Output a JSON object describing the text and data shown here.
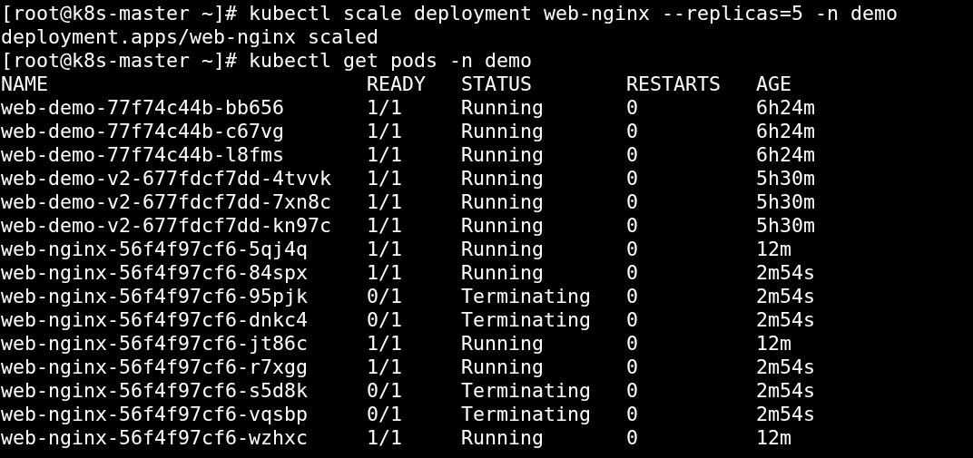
{
  "terminal": {
    "lines": [
      {
        "kind": "prompt",
        "prompt": "[root@k8s-master ~]#",
        "command": "kubectl scale deployment web-nginx --replicas=5 -n demo"
      },
      {
        "kind": "output",
        "text": "deployment.apps/web-nginx scaled"
      },
      {
        "kind": "prompt",
        "prompt": "[root@k8s-master ~]#",
        "command": "kubectl get pods -n demo"
      }
    ],
    "table": {
      "columns": [
        "NAME",
        "READY",
        "STATUS",
        "RESTARTS",
        "AGE"
      ],
      "rows": [
        [
          "web-demo-77f74c44b-bb656",
          "1/1",
          "Running",
          "0",
          "6h24m"
        ],
        [
          "web-demo-77f74c44b-c67vg",
          "1/1",
          "Running",
          "0",
          "6h24m"
        ],
        [
          "web-demo-77f74c44b-l8fms",
          "1/1",
          "Running",
          "0",
          "6h24m"
        ],
        [
          "web-demo-v2-677fdcf7dd-4tvvk",
          "1/1",
          "Running",
          "0",
          "5h30m"
        ],
        [
          "web-demo-v2-677fdcf7dd-7xn8c",
          "1/1",
          "Running",
          "0",
          "5h30m"
        ],
        [
          "web-demo-v2-677fdcf7dd-kn97c",
          "1/1",
          "Running",
          "0",
          "5h30m"
        ],
        [
          "web-nginx-56f4f97cf6-5qj4q",
          "1/1",
          "Running",
          "0",
          "12m"
        ],
        [
          "web-nginx-56f4f97cf6-84spx",
          "1/1",
          "Running",
          "0",
          "2m54s"
        ],
        [
          "web-nginx-56f4f97cf6-95pjk",
          "0/1",
          "Terminating",
          "0",
          "2m54s"
        ],
        [
          "web-nginx-56f4f97cf6-dnkc4",
          "0/1",
          "Terminating",
          "0",
          "2m54s"
        ],
        [
          "web-nginx-56f4f97cf6-jt86c",
          "1/1",
          "Running",
          "0",
          "12m"
        ],
        [
          "web-nginx-56f4f97cf6-r7xgg",
          "1/1",
          "Running",
          "0",
          "2m54s"
        ],
        [
          "web-nginx-56f4f97cf6-s5d8k",
          "0/1",
          "Terminating",
          "0",
          "2m54s"
        ],
        [
          "web-nginx-56f4f97cf6-vqsbp",
          "0/1",
          "Terminating",
          "0",
          "2m54s"
        ],
        [
          "web-nginx-56f4f97cf6-wzhxc",
          "1/1",
          "Running",
          "0",
          "12m"
        ]
      ]
    }
  }
}
